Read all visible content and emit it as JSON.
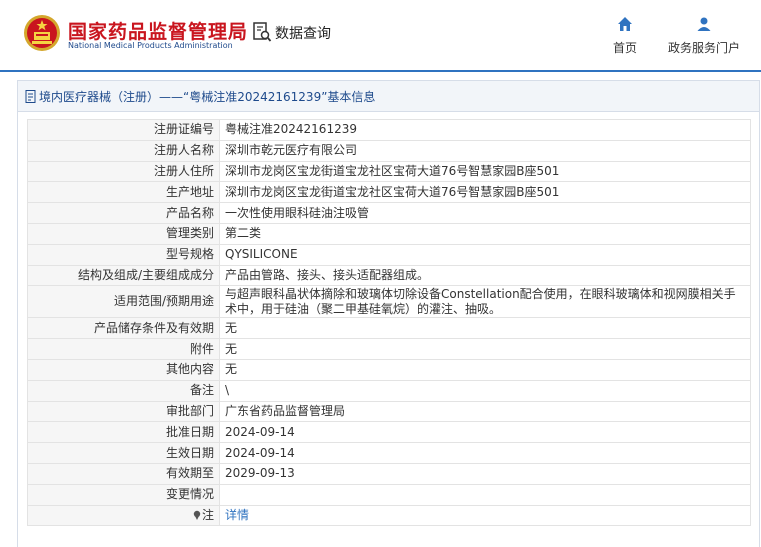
{
  "header": {
    "title_cn": "国家药品监督管理局",
    "title_en": "National Medical Products Administration",
    "query_label": "数据查询",
    "nav": [
      {
        "label": "首页",
        "icon": "home-icon"
      },
      {
        "label": "政务服务门户",
        "icon": "user-icon"
      }
    ]
  },
  "breadcrumb": "境内医疗器械（注册）——“粤械注准20242161239”基本信息",
  "rows": [
    {
      "label": "注册证编号",
      "value": "粤械注准20242161239"
    },
    {
      "label": "注册人名称",
      "value": "深圳市乾元医疗有限公司"
    },
    {
      "label": "注册人住所",
      "value": "深圳市龙岗区宝龙街道宝龙社区宝荷大道76号智慧家园B座501"
    },
    {
      "label": "生产地址",
      "value": "深圳市龙岗区宝龙街道宝龙社区宝荷大道76号智慧家园B座501"
    },
    {
      "label": "产品名称",
      "value": "一次性使用眼科硅油注吸管"
    },
    {
      "label": "管理类别",
      "value": "第二类"
    },
    {
      "label": "型号规格",
      "value": "QYSILICONE"
    },
    {
      "label": "结构及组成/主要组成成分",
      "value": "产品由管路、接头、接头适配器组成。"
    },
    {
      "label": "适用范围/预期用途",
      "value": "与超声眼科晶状体摘除和玻璃体切除设备Constellation配合使用，在眼科玻璃体和视网膜相关手术中，用于硅油（聚二甲基硅氧烷）的灌注、抽吸。"
    },
    {
      "label": "产品储存条件及有效期",
      "value": "无"
    },
    {
      "label": "附件",
      "value": "无"
    },
    {
      "label": "其他内容",
      "value": "无"
    },
    {
      "label": "备注",
      "value": "\\"
    },
    {
      "label": "审批部门",
      "value": "广东省药品监督管理局"
    },
    {
      "label": "批准日期",
      "value": "2024-09-14"
    },
    {
      "label": "生效日期",
      "value": "2024-09-14"
    },
    {
      "label": "有效期至",
      "value": "2029-09-13"
    },
    {
      "label": "变更情况",
      "value": ""
    },
    {
      "label": "注",
      "value": "详情",
      "icon": "pin-icon"
    }
  ]
}
